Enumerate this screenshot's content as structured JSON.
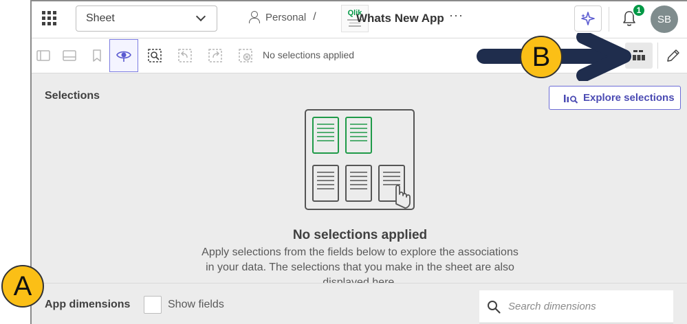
{
  "topbar": {
    "sheet_selector_value": "Sheet",
    "breadcrumb_space": "Personal",
    "breadcrumb_separator": "/",
    "app_thumb_logo": "Qlik",
    "app_title": "Whats New App",
    "more_label": "···",
    "notification_count": "1",
    "avatar_initials": "SB"
  },
  "toolbar": {
    "selection_status": "No selections applied"
  },
  "main": {
    "section_label": "Selections",
    "explore_button_label": "Explore selections",
    "empty_title": "No selections applied",
    "empty_description": "Apply selections from the fields below to explore the associations in your data. The selections that you make in the sheet are also displayed here."
  },
  "bottombar": {
    "app_dimensions_label": "App dimensions",
    "show_fields_label": "Show fields",
    "search_placeholder": "Search dimensions"
  },
  "callouts": {
    "a": "A",
    "b": "B"
  },
  "colors": {
    "accent_purple": "#6b6bd6",
    "green": "#009845",
    "callout_yellow": "#fbbf16",
    "arrow_navy": "#1f2d4d"
  }
}
